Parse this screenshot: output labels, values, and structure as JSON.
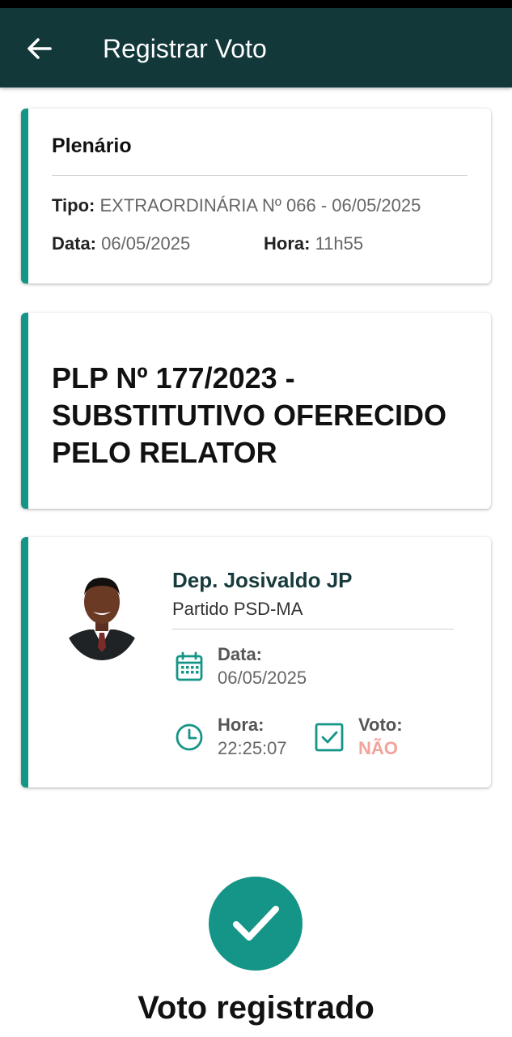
{
  "appbar": {
    "title": "Registrar Voto",
    "back_icon": "arrow-left-icon",
    "color": "#12383a"
  },
  "session": {
    "title": "Plenário",
    "tipo_label": "Tipo:",
    "tipo_value": "EXTRAORDINÁRIA Nº 066 - 06/05/2025",
    "data_label": "Data:",
    "data_value": "06/05/2025",
    "hora_label": "Hora:",
    "hora_value": "11h55"
  },
  "proposal": {
    "title": "PLP Nº 177/2023 - SUBSTITUTIVO OFERECIDO PELO RELATOR"
  },
  "deputy": {
    "name": "Dep. Josivaldo JP",
    "party": "Partido PSD-MA",
    "date_label": "Data:",
    "date_value": "06/05/2025",
    "time_label": "Hora:",
    "time_value": "22:25:07",
    "vote_label": "Voto:",
    "vote_value": "NÃO",
    "icons": [
      "calendar-icon",
      "clock-icon",
      "checkbox-icon"
    ]
  },
  "result": {
    "text": "Voto registrado",
    "icon": "check-circle-icon"
  },
  "colors": {
    "accent": "#159587",
    "vote_no": "#f2a39a"
  }
}
